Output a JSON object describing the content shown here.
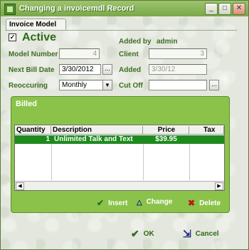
{
  "window": {
    "title": "Changing a invoicemdl Record",
    "minimize": "_",
    "maximize": "□",
    "close": "✕"
  },
  "tabs": [
    {
      "label": "Invoice Model"
    }
  ],
  "form": {
    "active_checked": "✓",
    "active_label": "Active",
    "added_by_label": "Added by",
    "added_by_value": "admin",
    "model_number_label": "Model Number",
    "model_number_value": "4",
    "client_label": "Client",
    "client_value": "3",
    "next_bill_date_label": "Next Bill Date",
    "next_bill_date_value": "3/30/2012",
    "added_label": "Added",
    "added_value": "3/30/12",
    "reoccuring_label": "Reoccuring",
    "reoccuring_value": "Monthly",
    "cut_off_label": "Cut Off",
    "cut_off_value": "",
    "ellipsis": "..."
  },
  "billed": {
    "title": "Billed",
    "columns": [
      "Quantity",
      "Description",
      "Price",
      "Tax"
    ],
    "rows": [
      {
        "quantity": "1",
        "description": "Unlimited Talk and Text",
        "price": "$39.95",
        "tax": ""
      }
    ],
    "insert_label": "Insert",
    "change_label": "Change",
    "delete_label": "Delete"
  },
  "footer": {
    "ok_label": "OK",
    "cancel_label": "Cancel"
  },
  "colors": {
    "accent": "#7aa84a",
    "panel": "#8bc34a",
    "selected_row": "#1e8a1e",
    "label": "#3f6d24"
  }
}
